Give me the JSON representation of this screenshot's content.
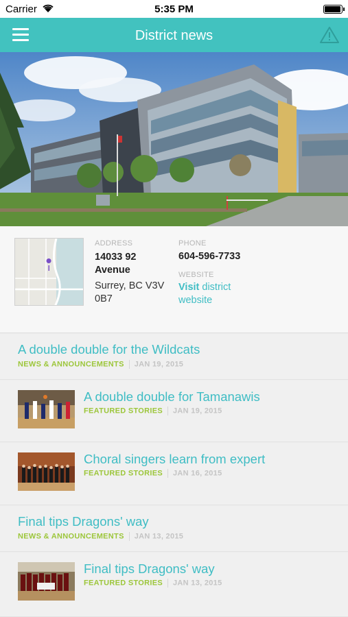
{
  "status_bar": {
    "carrier": "Carrier",
    "time": "5:35 PM"
  },
  "nav": {
    "title": "District news",
    "left_icon": "hamburger-menu-icon",
    "right_icon": "warning-triangle-icon"
  },
  "theme": {
    "accent": "#42c2bf",
    "link": "#3fbdc4",
    "category": "#9cc63a"
  },
  "info": {
    "address_label": "ADDRESS",
    "street": "14033 92 Avenue",
    "city": "Surrey, BC V3V 0B7",
    "phone_label": "PHONE",
    "phone": "604-596-7733",
    "website_label": "WEBSITE",
    "website_link_bold": "Visit",
    "website_link_rest": "district website"
  },
  "news": [
    {
      "headline": "A double double for the Wildcats",
      "category": "NEWS & ANNOUNCEMENTS",
      "date": "JAN 19, 2015",
      "thumb": ""
    },
    {
      "headline": "A double double for Tamanawis",
      "category": "FEATURED STORIES",
      "date": "JAN 19, 2015",
      "thumb": "basketball"
    },
    {
      "headline": "Choral singers learn from expert",
      "category": "FEATURED STORIES",
      "date": "JAN 16, 2015",
      "thumb": "choir"
    },
    {
      "headline": "Final tips Dragons' way",
      "category": "NEWS & ANNOUNCEMENTS",
      "date": "JAN 13, 2015",
      "thumb": ""
    },
    {
      "headline": "Final tips Dragons' way",
      "category": "FEATURED STORIES",
      "date": "JAN 13, 2015",
      "thumb": "team"
    }
  ]
}
